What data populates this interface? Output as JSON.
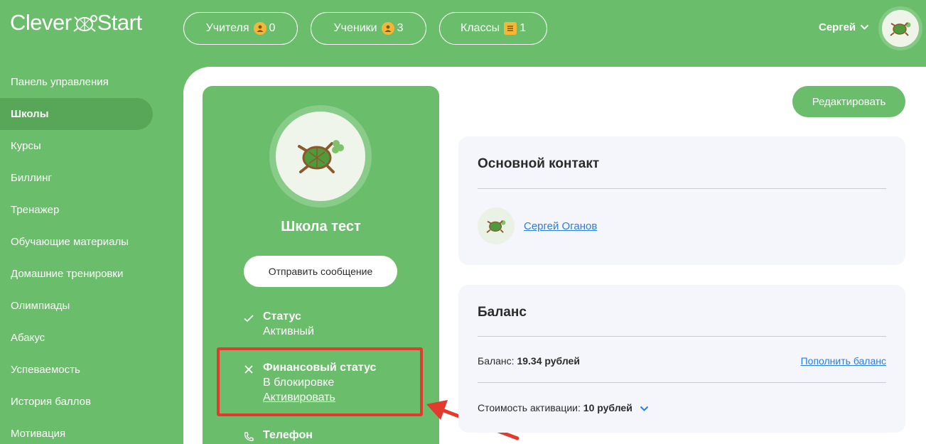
{
  "header": {
    "logo_left": "Clever",
    "logo_right": "Start",
    "counters": [
      {
        "label": "Учителя",
        "icon": "person-icon",
        "count": "0"
      },
      {
        "label": "Ученики",
        "icon": "person-icon",
        "count": "3"
      },
      {
        "label": "Классы",
        "icon": "list-icon",
        "count": "1"
      }
    ],
    "user_name": "Сергей"
  },
  "sidebar": {
    "items": [
      {
        "label": "Панель управления",
        "active": false
      },
      {
        "label": "Школы",
        "active": true
      },
      {
        "label": "Курсы",
        "active": false
      },
      {
        "label": "Биллинг",
        "active": false
      },
      {
        "label": "Тренажер",
        "active": false
      },
      {
        "label": "Обучающие материалы",
        "active": false
      },
      {
        "label": "Домашние тренировки",
        "active": false
      },
      {
        "label": "Олимпиады",
        "active": false
      },
      {
        "label": "Абакус",
        "active": false
      },
      {
        "label": "Успеваемость",
        "active": false
      },
      {
        "label": "История баллов",
        "active": false
      },
      {
        "label": "Мотивация",
        "active": false
      }
    ]
  },
  "school": {
    "name": "Школа тест",
    "send_message_label": "Отправить сообщение",
    "status_title": "Статус",
    "status_value": "Активный",
    "finance_title": "Финансовый статус",
    "finance_value": "В блокировке",
    "activate_label": "Активировать",
    "phone_title": "Телефон"
  },
  "main": {
    "edit_label": "Редактировать",
    "contact": {
      "title": "Основной контакт",
      "name": "Сергей Оганов"
    },
    "balance": {
      "title": "Баланс",
      "balance_label": "Баланс:",
      "balance_value": "19.34 рублей",
      "topup_label": "Пополнить баланс",
      "activation_label": "Стоимость активации:",
      "activation_value": "10 рублей"
    }
  },
  "colors": {
    "brand_green": "#6abd6a",
    "active_green": "#58a758",
    "link_blue": "#2a7de1",
    "alert_red": "#e23a2e"
  }
}
